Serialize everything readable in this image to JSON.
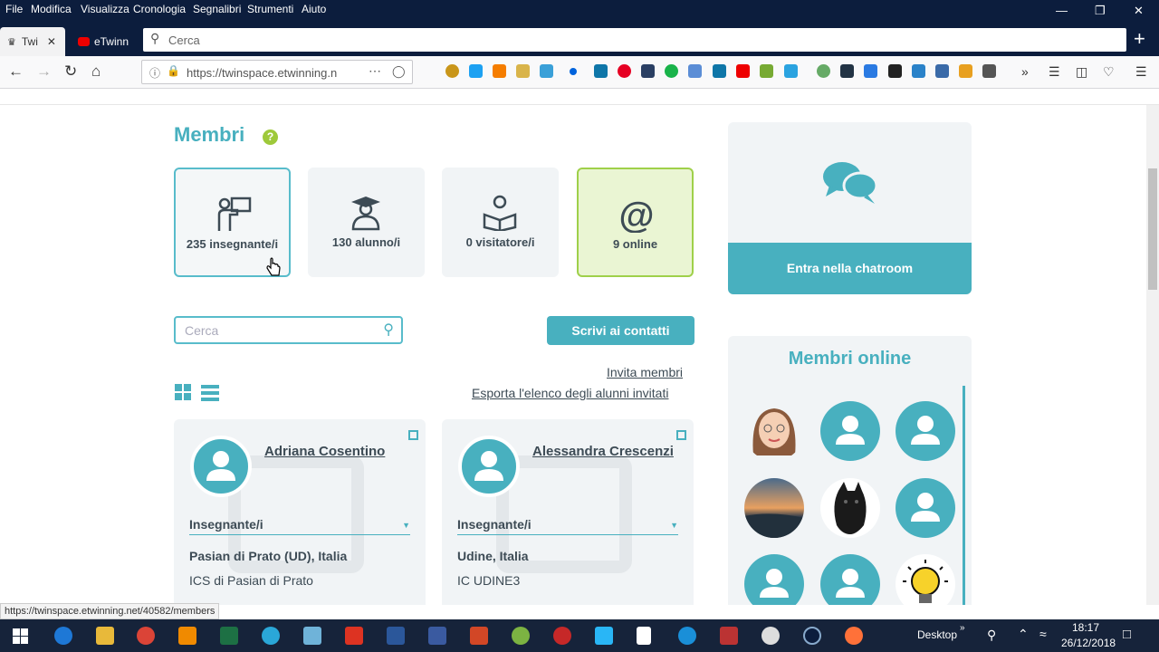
{
  "menu": [
    "File",
    "Modifica",
    "Visualizza",
    "Cronologia",
    "Segnalibri",
    "Strumenti",
    "Aiuto"
  ],
  "tabs": [
    {
      "label": "Twi"
    },
    {
      "label": "eTwinn"
    }
  ],
  "search_placeholder": "Cerca",
  "url": "https://twinspace.etwinning.n",
  "page": {
    "title": "Membri",
    "help": "?",
    "stats": [
      {
        "label": "235 insegnante/i"
      },
      {
        "label": "130 alunno/i"
      },
      {
        "label": "0 visitatore/i"
      },
      {
        "label": "9 online"
      }
    ],
    "search_placeholder": "Cerca",
    "write_button": "Scrivi ai contatti",
    "invite_link": "Invita membri",
    "export_link": "Esporta l'elenco degli alunni invitati",
    "cards": [
      {
        "name": "Adriana Cosentino",
        "role": "Insegnante/i",
        "location": "Pasian di Prato (UD), Italia",
        "school": "ICS di Pasian di Prato"
      },
      {
        "name": "Alessandra Crescenzi",
        "role": "Insegnante/i",
        "location": "Udine, Italia",
        "school": "IC UDINE3"
      }
    ],
    "chat_button": "Entra nella chatroom",
    "online_title": "Membri online"
  },
  "status_url": "https://twinspace.etwinning.net/40582/members",
  "taskbar": {
    "desktop": "Desktop",
    "time": "18:17",
    "date": "26/12/2018"
  },
  "colors": {
    "accent": "#48b0bf",
    "online_green": "#9fd04a",
    "titlebar": "#0c1d3d"
  }
}
